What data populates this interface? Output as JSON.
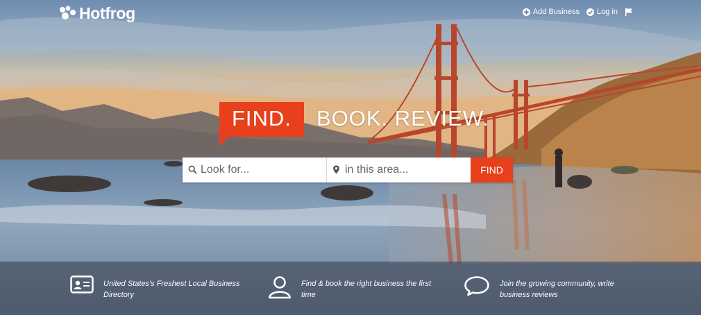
{
  "brand": {
    "name": "Hotfrog"
  },
  "nav": {
    "add_business": "Add Business",
    "log_in": "Log in"
  },
  "headline": {
    "find": "FIND.",
    "rest": "BOOK. REVIEW."
  },
  "search": {
    "what_placeholder": "Look for...",
    "where_placeholder": "in this area...",
    "button": "FIND"
  },
  "features": [
    {
      "icon": "id-card-icon",
      "text": "United States's Freshest Local Business Directory"
    },
    {
      "icon": "user-icon",
      "text": "Find & book the right business the first time"
    },
    {
      "icon": "chat-bubble-icon",
      "text": "Join the growing community, write business reviews"
    }
  ],
  "colors": {
    "accent": "#e8401c",
    "bridge": "#b8462a",
    "overlay": "#3c4655"
  }
}
